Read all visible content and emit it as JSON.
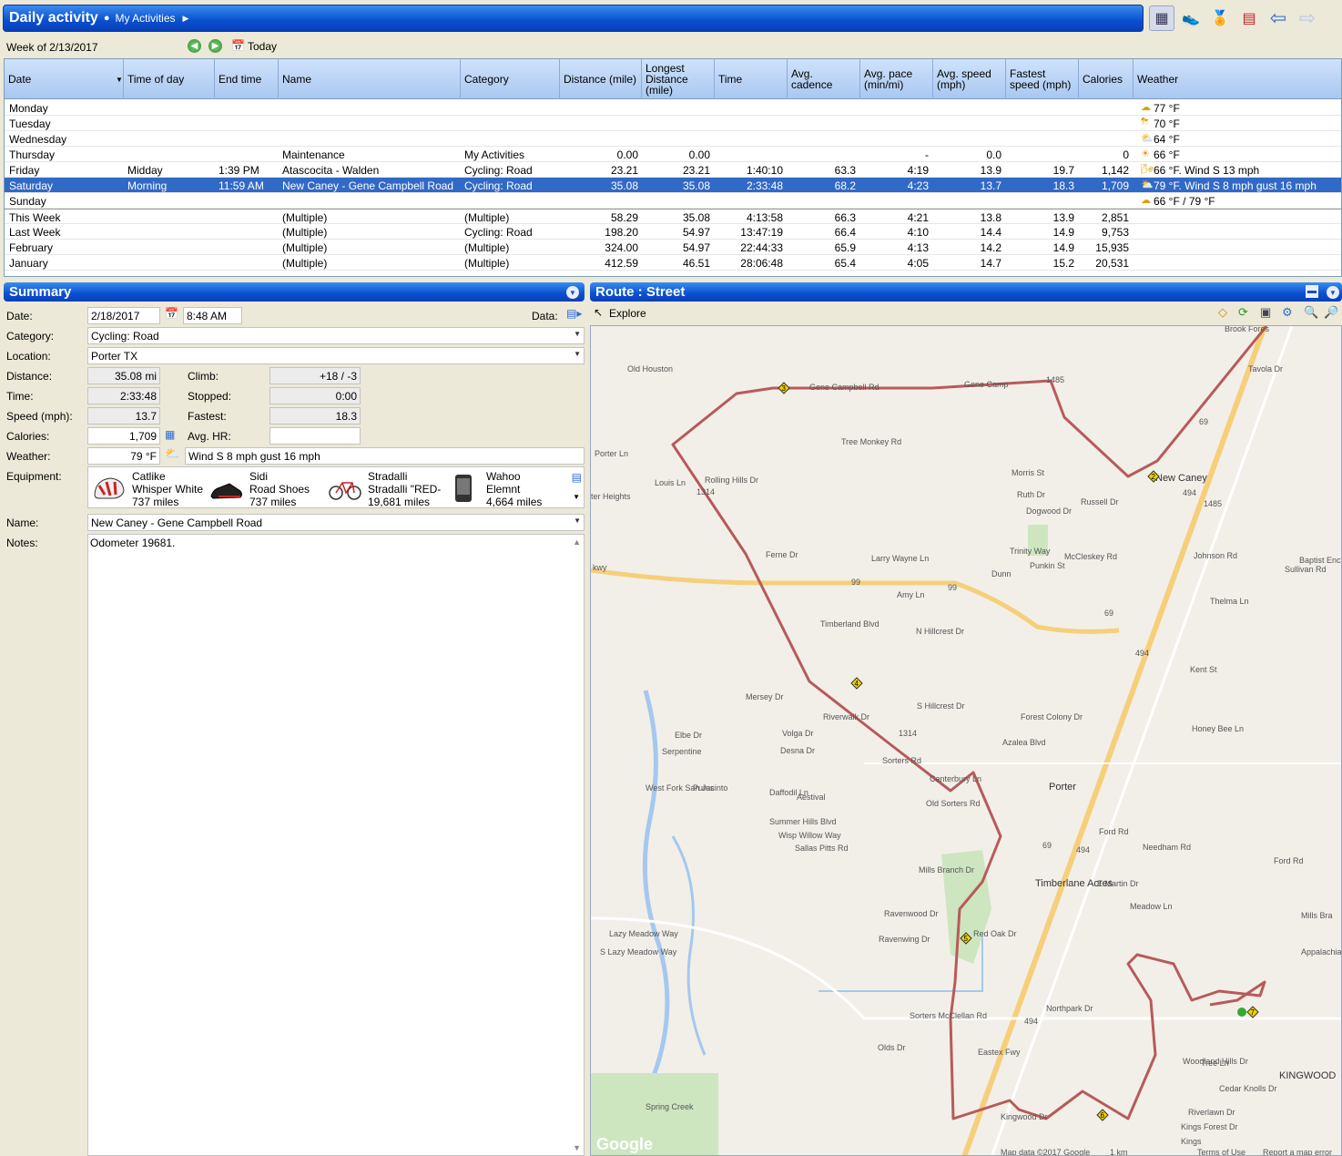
{
  "app": {
    "title": "Daily activity",
    "crumb": "My Activities"
  },
  "toolbar": {
    "icons": [
      "calendar-grid-icon",
      "shoe-icon",
      "medal-icon",
      "report-icon",
      "back-arrow-icon",
      "forward-arrow-icon"
    ]
  },
  "week": {
    "label": "Week of 2/13/2017",
    "today": "Today"
  },
  "grid": {
    "headers": [
      "Date",
      "Time of day",
      "End time",
      "Name",
      "Category",
      "Distance (mile)",
      "Longest Distance (mile)",
      "Time",
      "Avg. cadence",
      "Avg. pace (min/mi)",
      "Avg. speed (mph)",
      "Fastest speed (mph)",
      "Calories",
      "Weather"
    ],
    "rows": [
      {
        "date": "Monday",
        "tod": "",
        "end": "",
        "name": "",
        "cat": "",
        "dist": "",
        "longest": "",
        "time": "",
        "cad": "",
        "pace": "",
        "avg": "",
        "fast": "",
        "cal": "",
        "weather": "77 °F",
        "wicon": "cloudy-icon"
      },
      {
        "date": "Tuesday",
        "tod": "",
        "end": "",
        "name": "",
        "cat": "",
        "dist": "",
        "longest": "",
        "time": "",
        "cad": "",
        "pace": "",
        "avg": "",
        "fast": "",
        "cal": "",
        "weather": "70 °F",
        "wicon": "storm-icon"
      },
      {
        "date": "Wednesday",
        "tod": "",
        "end": "",
        "name": "",
        "cat": "",
        "dist": "",
        "longest": "",
        "time": "",
        "cad": "",
        "pace": "",
        "avg": "",
        "fast": "",
        "cal": "",
        "weather": "64 °F",
        "wicon": "partly-sunny-icon"
      },
      {
        "date": "Thursday",
        "tod": "",
        "end": "",
        "name": "Maintenance",
        "cat": "My Activities",
        "dist": "0.00",
        "longest": "0.00",
        "time": "",
        "cad": "",
        "pace": "-",
        "avg": "0.0",
        "fast": "",
        "cal": "0",
        "weather": "66 °F",
        "wicon": "sunny-icon"
      },
      {
        "date": "Friday",
        "tod": "Midday",
        "end": "1:39 PM",
        "name": "Atascocita - Walden",
        "cat": "Cycling: Road",
        "dist": "23.21",
        "longest": "23.21",
        "time": "1:40:10",
        "cad": "63.3",
        "pace": "4:19",
        "avg": "13.9",
        "fast": "19.7",
        "cal": "1,142",
        "weather": "66 °F. Wind S 13 mph",
        "wicon": "wind-icon"
      },
      {
        "date": "Saturday",
        "tod": "Morning",
        "end": "11:59 AM",
        "name": "New Caney - Gene Campbell Road",
        "cat": "Cycling: Road",
        "dist": "35.08",
        "longest": "35.08",
        "time": "2:33:48",
        "cad": "68.2",
        "pace": "4:23",
        "avg": "13.7",
        "fast": "18.3",
        "cal": "1,709",
        "weather": "79 °F. Wind S 8 mph gust 16 mph",
        "wicon": "partly-sunny-icon"
      },
      {
        "date": "Sunday",
        "tod": "",
        "end": "",
        "name": "",
        "cat": "",
        "dist": "",
        "longest": "",
        "time": "",
        "cad": "",
        "pace": "",
        "avg": "",
        "fast": "",
        "cal": "",
        "weather": "66 °F / 79 °F",
        "wicon": "cloudy-icon"
      },
      {
        "date": "This Week",
        "tod": "",
        "end": "",
        "name": "(Multiple)",
        "cat": "(Multiple)",
        "dist": "58.29",
        "longest": "35.08",
        "time": "4:13:58",
        "cad": "66.3",
        "pace": "4:21",
        "avg": "13.8",
        "fast": "13.9",
        "cal": "2,851",
        "weather": "",
        "wicon": ""
      },
      {
        "date": "Last Week",
        "tod": "",
        "end": "",
        "name": "(Multiple)",
        "cat": "Cycling: Road",
        "dist": "198.20",
        "longest": "54.97",
        "time": "13:47:19",
        "cad": "66.4",
        "pace": "4:10",
        "avg": "14.4",
        "fast": "14.9",
        "cal": "9,753",
        "weather": "",
        "wicon": ""
      },
      {
        "date": "February",
        "tod": "",
        "end": "",
        "name": "(Multiple)",
        "cat": "(Multiple)",
        "dist": "324.00",
        "longest": "54.97",
        "time": "22:44:33",
        "cad": "65.9",
        "pace": "4:13",
        "avg": "14.2",
        "fast": "14.9",
        "cal": "15,935",
        "weather": "",
        "wicon": ""
      },
      {
        "date": "January",
        "tod": "",
        "end": "",
        "name": "(Multiple)",
        "cat": "(Multiple)",
        "dist": "412.59",
        "longest": "46.51",
        "time": "28:06:48",
        "cad": "65.4",
        "pace": "4:05",
        "avg": "14.7",
        "fast": "15.2",
        "cal": "20,531",
        "weather": "",
        "wicon": ""
      }
    ]
  },
  "summary": {
    "title": "Summary",
    "labels": {
      "date": "Date:",
      "data": "Data:",
      "category": "Category:",
      "location": "Location:",
      "distance": "Distance:",
      "climb": "Climb:",
      "time": "Time:",
      "stopped": "Stopped:",
      "speed": "Speed (mph):",
      "fastest": "Fastest:",
      "calories": "Calories:",
      "avghr": "Avg. HR:",
      "weather": "Weather:",
      "equipment": "Equipment:",
      "name": "Name:",
      "notes": "Notes:"
    },
    "values": {
      "date": "2/18/2017",
      "start": "8:48 AM",
      "category": "Cycling: Road",
      "location": "Porter TX",
      "distance": "35.08 mi",
      "climb": "+18 / -3",
      "time": "2:33:48",
      "stopped": "0:00",
      "speed": "13.7",
      "fastest": "18.3",
      "calories": "1,709",
      "avghr": "",
      "temp": "79 °F",
      "weather": "Wind S 8 mph gust 16 mph",
      "name": "New Caney - Gene Campbell Road",
      "notes": "Odometer 19681."
    },
    "equipment": [
      {
        "l1": "Catlike",
        "l2": "Whisper White",
        "l3": "737 miles"
      },
      {
        "l1": "Sidi",
        "l2": "Road Shoes",
        "l3": "737 miles"
      },
      {
        "l1": "Stradalli",
        "l2": "Stradalli \"RED-",
        "l3": "19,681 miles"
      },
      {
        "l1": "Wahoo",
        "l2": "Elemnt",
        "l3": "4,664 miles"
      }
    ]
  },
  "route": {
    "title": "Route : Street",
    "explore": "Explore",
    "labels": {
      "houston": "Old Houston",
      "porterln": "Porter Ln",
      "louis": "Louis Ln",
      "heights": "ter Heights",
      "rolling": "Rolling Hills Dr",
      "gene": "Gene Campbell Rd",
      "gene2": "Gene Camp",
      "treemonkey": "Tree Monkey Rd",
      "morris": "Morris St",
      "ruth": "Ruth Dr",
      "russell": "Russell Dr",
      "dogwood": "Dogwood Dr",
      "trinity": "Trinity Way",
      "mccleskey": "McCleskey Rd",
      "punkin": "Punkin St",
      "dunn": "Dunn",
      "larry": "Larry Wayne Ln",
      "ferne": "Ferne Dr",
      "amy": "Amy Ln",
      "timberland": "Timberland Blvd",
      "hillcrest": "N Hillcrest Dr",
      "shillcrest": "S Hillcrest Dr",
      "forest": "Forest Colony Dr",
      "azalea": "Azalea Blvd",
      "johnson": "Johnson Rd",
      "thelma": "Thelma Ln",
      "sullivan": "Sullivan Rd",
      "kent": "Kent St",
      "honeybee": "Honey Bee Ln",
      "tavola": "Tavola Dr",
      "brook": "Brook Fores",
      "baptist": "Baptist Encamp",
      "mersey": "Mersey Dr",
      "volga": "Volga Dr",
      "desna": "Desna Dr",
      "elbe": "Elbe Dr",
      "riverwalk": "Riverwalk Dr",
      "serpent": "Serpentine",
      "purus": "Purus",
      "westfork": "West Fork San Jacinto",
      "daffodil": "Daffodil Ln",
      "aestival": "Aestival",
      "summer": "Summer Hills Blvd",
      "wisp": "Wisp Willow Way",
      "sallas": "Sallas Pitts Rd",
      "mills": "Mills Branch Dr",
      "raven": "Ravenwood Dr",
      "ravenwing": "Ravenwing Dr",
      "redoak": "Red Oak Dr",
      "oldsorters": "Old Sorters Rd",
      "sorters": "Sorters Rd",
      "canterbury": "Canterbury Ln",
      "porter": "Porter",
      "newcaney": "New Caney",
      "timberlane": "Timberlane Acres",
      "emartin": "E Martin Dr",
      "fordrd": "Ford Rd",
      "needham": "Needham Rd",
      "meadow": "Meadow Ln",
      "fordrd2": "Ford Rd",
      "mills2": "Mills Bra",
      "appalachia": "Appalachia",
      "northpark": "Northpark Dr",
      "mcclellan": "Sorters McClellan Rd",
      "olds": "Olds Dr",
      "eastex": "Eastex Fwy",
      "woodland": "Woodland Hills Dr",
      "tree": "Tree Ln",
      "cedar": "Cedar Knolls Dr",
      "riverlawn": "Riverlawn Dr",
      "kingsforest": "Kings Forest Dr",
      "kingwoodpl": "Kings",
      "kingwood": "Kingwood Dr",
      "kingwoodtown": "KINGWOOD",
      "lazy": "S Lazy Meadow Way",
      "lazy2": "Lazy Meadow Way",
      "spring": "Spring Creek",
      "pkwy": "kwy",
      "s1485a": "1485",
      "s1485b": "1485",
      "s69a": "69",
      "s69b": "69",
      "s69c": "69",
      "s494a": "494",
      "s494b": "494",
      "s494c": "494",
      "s494d": "494",
      "s99a": "99",
      "s99b": "99",
      "s1314a": "1314",
      "s1314b": "1314",
      "google": "Google",
      "mapdata": "Map data ©2017 Google",
      "scale": "1 km",
      "terms": "Terms of Use",
      "report": "Report a map error"
    },
    "markers": [
      "2",
      "3",
      "4",
      "5",
      "6",
      "7"
    ]
  }
}
